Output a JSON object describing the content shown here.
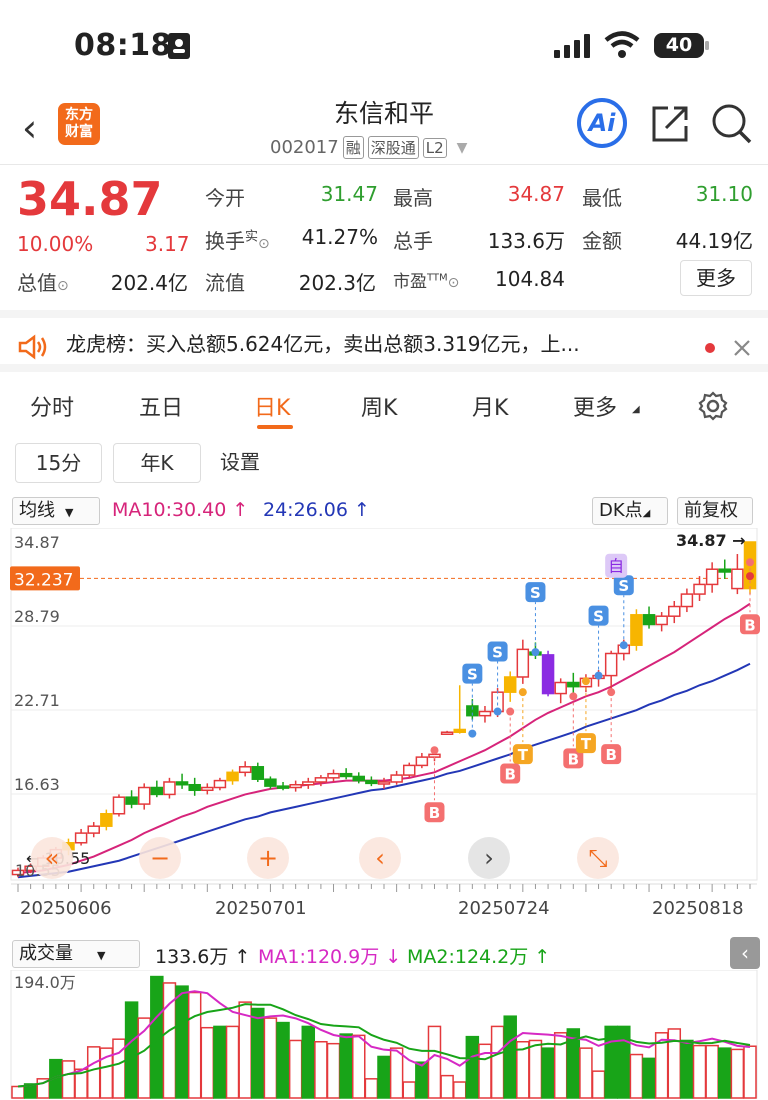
{
  "status": {
    "time": "08:18",
    "battery": "40"
  },
  "header": {
    "logo": "东方财富",
    "logo_top": "东方",
    "logo_bottom": "财富",
    "title": "东信和平",
    "code": "002017",
    "tags": [
      "融",
      "深股通",
      "L2"
    ],
    "ai": "Ai"
  },
  "quote": {
    "price": "34.87",
    "pct": "10.00%",
    "change": "3.17",
    "open_label": "今开",
    "open": "31.47",
    "high_label": "最高",
    "high": "34.87",
    "low_label": "最低",
    "low": "31.10",
    "turnover_label": "换手",
    "turnover_sup": "实",
    "turnover": "41.27%",
    "volume_label": "总手",
    "volume": "133.6万",
    "amount_label": "金额",
    "amount": "44.19亿",
    "mktcap_label": "总值",
    "mktcap": "202.4亿",
    "float_label": "流值",
    "float": "202.3亿",
    "pe_label": "市盈",
    "pe_sup": "TTM",
    "pe": "104.84",
    "more": "更多"
  },
  "banner": {
    "text": "龙虎榜：买入总额5.624亿元，卖出总额3.319亿元，上..."
  },
  "tabs": [
    "分时",
    "五日",
    "日K",
    "周K",
    "月K",
    "更多"
  ],
  "active_tab": "日K",
  "subtabs": [
    "15分",
    "年K",
    "设置"
  ],
  "kline": {
    "indicator": "均线",
    "ma10": "MA10:30.40",
    "ma24": "24:26.06",
    "dk": "DK点",
    "adjust": "前复权",
    "ylabels": [
      "34.87",
      "32.237",
      "28.79",
      "22.71",
      "16.63",
      "10.55"
    ],
    "last_label": "34.87",
    "low_label": "10.55",
    "dates": [
      "20250606",
      "20250701",
      "20250724",
      "20250818"
    ],
    "marker_s": "S",
    "marker_b": "B",
    "marker_t": "T",
    "marker_zi": "自"
  },
  "volume": {
    "indicator": "成交量",
    "value": "133.6万",
    "ma1": "MA1:120.9万",
    "ma2": "MA2:124.2万",
    "max": "194.0万"
  },
  "colors": {
    "up": "#e4393c",
    "down": "#18a418",
    "accent": "#f26a1b",
    "ma10": "#d6247a",
    "ma24": "#2337b6"
  },
  "chart_data": {
    "type": "candlestick",
    "ohlc": [
      [
        10.8,
        11.3,
        10.6,
        11.1
      ],
      [
        11.1,
        11.6,
        10.9,
        11.4
      ],
      [
        11.4,
        12.2,
        11.2,
        12.0
      ],
      [
        12.0,
        12.8,
        11.8,
        12.6
      ],
      [
        12.6,
        13.4,
        12.2,
        13.1
      ],
      [
        13.1,
        14.1,
        12.9,
        13.8
      ],
      [
        13.8,
        14.6,
        13.5,
        14.3
      ],
      [
        14.3,
        15.5,
        14.0,
        15.2
      ],
      [
        15.2,
        16.6,
        15.0,
        16.4
      ],
      [
        16.4,
        16.9,
        15.6,
        15.9
      ],
      [
        15.9,
        17.4,
        15.5,
        17.1
      ],
      [
        17.1,
        17.6,
        16.4,
        16.6
      ],
      [
        16.6,
        17.8,
        16.3,
        17.5
      ],
      [
        17.5,
        18.1,
        17.0,
        17.3
      ],
      [
        17.3,
        17.8,
        16.5,
        16.9
      ],
      [
        16.9,
        17.4,
        16.6,
        17.1
      ],
      [
        17.1,
        17.8,
        16.9,
        17.6
      ],
      [
        17.6,
        18.4,
        17.3,
        18.2
      ],
      [
        18.2,
        19.0,
        17.9,
        18.6
      ],
      [
        18.6,
        18.9,
        17.5,
        17.7
      ],
      [
        17.7,
        17.9,
        17.0,
        17.2
      ],
      [
        17.2,
        17.5,
        16.9,
        17.1
      ],
      [
        17.1,
        17.6,
        16.8,
        17.3
      ],
      [
        17.3,
        17.8,
        17.0,
        17.5
      ],
      [
        17.5,
        18.0,
        17.2,
        17.8
      ],
      [
        17.8,
        18.4,
        17.5,
        18.1
      ],
      [
        18.1,
        18.5,
        17.7,
        17.9
      ],
      [
        17.9,
        18.2,
        17.4,
        17.6
      ],
      [
        17.6,
        17.9,
        17.2,
        17.4
      ],
      [
        17.4,
        17.8,
        17.0,
        17.5
      ],
      [
        17.5,
        18.3,
        17.3,
        18.0
      ],
      [
        18.0,
        18.9,
        17.8,
        18.7
      ],
      [
        18.7,
        19.6,
        18.5,
        19.3
      ],
      [
        19.3,
        20.0,
        19.0,
        19.5
      ],
      [
        21.0,
        21.2,
        20.9,
        21.1
      ],
      [
        21.1,
        24.5,
        21.0,
        21.3
      ],
      [
        23.0,
        23.5,
        22.0,
        22.3
      ],
      [
        22.3,
        23.0,
        21.8,
        22.6
      ],
      [
        22.6,
        24.3,
        22.2,
        24.0
      ],
      [
        24.0,
        25.5,
        23.3,
        25.1
      ],
      [
        25.1,
        27.8,
        24.6,
        27.1
      ],
      [
        26.9,
        27.6,
        26.4,
        26.7
      ],
      [
        26.7,
        27.0,
        23.7,
        23.9
      ],
      [
        23.9,
        25.0,
        23.2,
        24.7
      ],
      [
        24.7,
        25.4,
        23.9,
        24.4
      ],
      [
        24.4,
        25.3,
        24.0,
        25.0
      ],
      [
        25.0,
        25.6,
        24.4,
        25.2
      ],
      [
        25.2,
        27.0,
        24.0,
        26.8
      ],
      [
        26.8,
        27.8,
        26.3,
        27.4
      ],
      [
        27.4,
        30.0,
        27.0,
        29.6
      ],
      [
        29.6,
        30.2,
        28.6,
        28.9
      ],
      [
        28.9,
        29.8,
        28.4,
        29.5
      ],
      [
        29.5,
        30.6,
        29.0,
        30.2
      ],
      [
        30.2,
        31.5,
        29.8,
        31.1
      ],
      [
        31.1,
        32.4,
        30.6,
        31.8
      ],
      [
        31.8,
        33.4,
        31.2,
        32.9
      ],
      [
        32.9,
        33.6,
        32.2,
        32.7
      ],
      [
        31.5,
        34.0,
        31.1,
        32.9
      ],
      [
        31.5,
        34.87,
        31.1,
        34.87
      ]
    ],
    "ma10": [
      10.9,
      11.0,
      11.1,
      11.3,
      11.5,
      11.8,
      12.1,
      12.5,
      12.9,
      13.3,
      13.8,
      14.2,
      14.6,
      15.0,
      15.3,
      15.7,
      16.0,
      16.3,
      16.6,
      16.8,
      17.0,
      17.1,
      17.2,
      17.3,
      17.4,
      17.5,
      17.6,
      17.6,
      17.6,
      17.6,
      17.7,
      17.8,
      18.0,
      18.2,
      18.6,
      19.0,
      19.4,
      19.8,
      20.3,
      20.8,
      21.4,
      22.0,
      22.5,
      22.9,
      23.3,
      23.7,
      24.0,
      24.4,
      24.9,
      25.4,
      25.9,
      26.4,
      26.9,
      27.5,
      28.1,
      28.7,
      29.3,
      29.8,
      30.4
    ],
    "ma24": [
      10.6,
      10.7,
      10.8,
      10.9,
      11.0,
      11.2,
      11.4,
      11.6,
      11.8,
      12.1,
      12.4,
      12.7,
      13.0,
      13.3,
      13.6,
      13.9,
      14.2,
      14.5,
      14.8,
      15.0,
      15.3,
      15.5,
      15.7,
      15.9,
      16.1,
      16.3,
      16.5,
      16.7,
      16.9,
      17.0,
      17.2,
      17.4,
      17.6,
      17.8,
      18.1,
      18.3,
      18.6,
      18.9,
      19.2,
      19.5,
      19.9,
      20.2,
      20.5,
      20.8,
      21.1,
      21.5,
      21.8,
      22.1,
      22.4,
      22.7,
      23.1,
      23.4,
      23.8,
      24.1,
      24.5,
      24.8,
      25.2,
      25.6,
      26.06
    ],
    "volume_up": [
      true,
      false,
      true,
      false,
      true,
      true,
      true,
      true,
      true,
      false,
      true,
      false,
      true,
      false,
      true,
      true,
      false,
      true,
      true,
      false,
      true,
      false,
      true,
      false,
      true,
      true,
      false,
      true,
      true,
      false,
      true,
      true,
      false,
      true,
      true,
      true,
      false,
      true,
      true,
      false,
      true,
      true,
      false,
      true,
      false,
      true,
      true,
      false,
      false,
      true,
      false,
      true,
      true,
      false,
      true,
      true,
      false,
      true,
      true
    ],
    "volume": [
      18,
      22,
      30,
      60,
      58,
      45,
      80,
      78,
      92,
      150,
      125,
      190,
      180,
      175,
      165,
      110,
      112,
      112,
      150,
      140,
      125,
      118,
      90,
      112,
      88,
      85,
      100,
      98,
      30,
      65,
      78,
      25,
      56,
      112,
      35,
      25,
      96,
      84,
      112,
      128,
      88,
      90,
      78,
      102,
      108,
      78,
      42,
      112,
      112,
      68,
      62,
      102,
      108,
      90,
      82,
      82,
      78,
      76,
      81
    ],
    "ylim": [
      10.55,
      34.87
    ]
  }
}
